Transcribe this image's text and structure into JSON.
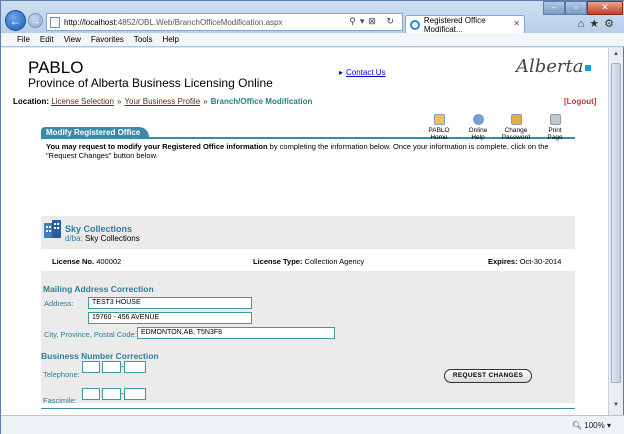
{
  "browser": {
    "url_prefix": "http://localhost",
    "url_rest": ":4852/OBL.Web/BranchOfficeModification.aspx",
    "tab_title": "Registered Office Modificat...",
    "menu": [
      "File",
      "Edit",
      "View",
      "Favorites",
      "Tools",
      "Help"
    ],
    "zoom": "100%"
  },
  "header": {
    "app_name": "PABLO",
    "subtitle": "Province of Alberta Business Licensing Online",
    "contact_link": "Contact Us",
    "logo_text": "Alberta"
  },
  "location": {
    "label": "Location:",
    "crumbs": [
      "License Selection",
      "Your Business Profile"
    ],
    "separator": "»",
    "current": "Branch/Office Modification",
    "logout": "[Logout]"
  },
  "section_title": "Modify Registered Office",
  "toolbar": [
    {
      "label1": "PABLO",
      "label2": "Home",
      "icon": "home-icon",
      "color": "#f0c060"
    },
    {
      "label1": "Online",
      "label2": "Help",
      "icon": "help-icon",
      "color": "#6fa0e0"
    },
    {
      "label1": "Change",
      "label2": "Password",
      "icon": "key-icon",
      "color": "#e0b040"
    },
    {
      "label1": "Print",
      "label2": "Page",
      "icon": "printer-icon",
      "color": "#c0c8d0"
    }
  ],
  "intro": {
    "bold": "You may request to modify your Registered Office information",
    "rest": " by completing the information below. Once your information is complete, click on the \"Request Changes\" button below."
  },
  "business": {
    "name": "Sky Collections",
    "dba_label": "d/ba:",
    "dba_value": "Sky Collections",
    "license_no_label": "License No.",
    "license_no": "400002",
    "license_type_label": "License Type:",
    "license_type": "Collection Agency",
    "expires_label": "Expires:",
    "expires": "Oct-30-2014"
  },
  "mailing": {
    "title": "Mailing Address Correction",
    "address_label": "Address:",
    "address_line1": "TEST3 HOUSE",
    "address_line2": "19760 - 456 AVENUE",
    "city_label": "City, Province, Postal Code:",
    "city_value": "EDMONTON,AB, T5N3F8"
  },
  "business_number": {
    "title": "Business Number Correction",
    "telephone_label": "Telephone:",
    "fax_label": "Fascimile:"
  },
  "request_button": "REQUEST CHANGES"
}
